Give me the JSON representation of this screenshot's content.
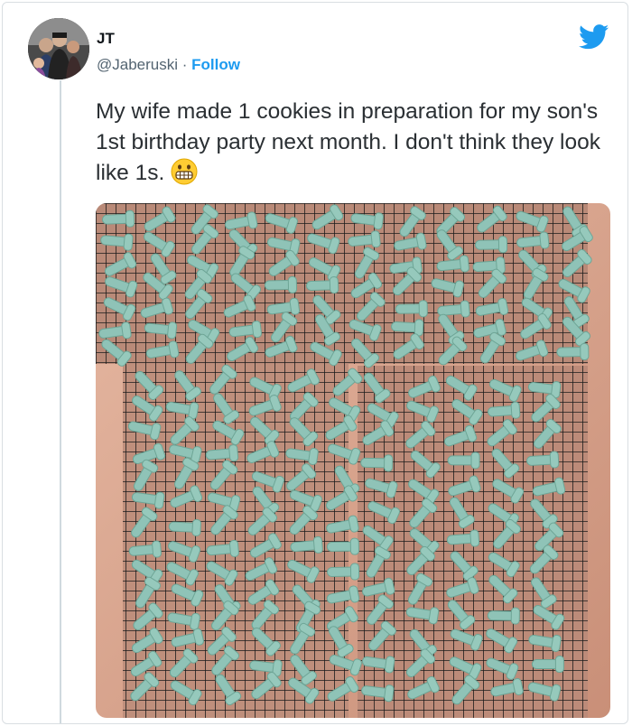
{
  "user": {
    "name": "JT",
    "handle": "@Jaberuski",
    "separator": "·",
    "follow_label": "Follow"
  },
  "tweet": {
    "text": "My wife made 1 cookies in preparation for my son's 1st birthday party next month. I don't think they look like 1s."
  },
  "icons": {
    "brand": "twitter-bird-icon",
    "emoji": "grimacing-face-emoji"
  },
  "colors": {
    "accent": "#1d9bf0",
    "cookie": "#8fc3b7",
    "rack": "#1c1c1c",
    "counter": "#d9a88f"
  }
}
